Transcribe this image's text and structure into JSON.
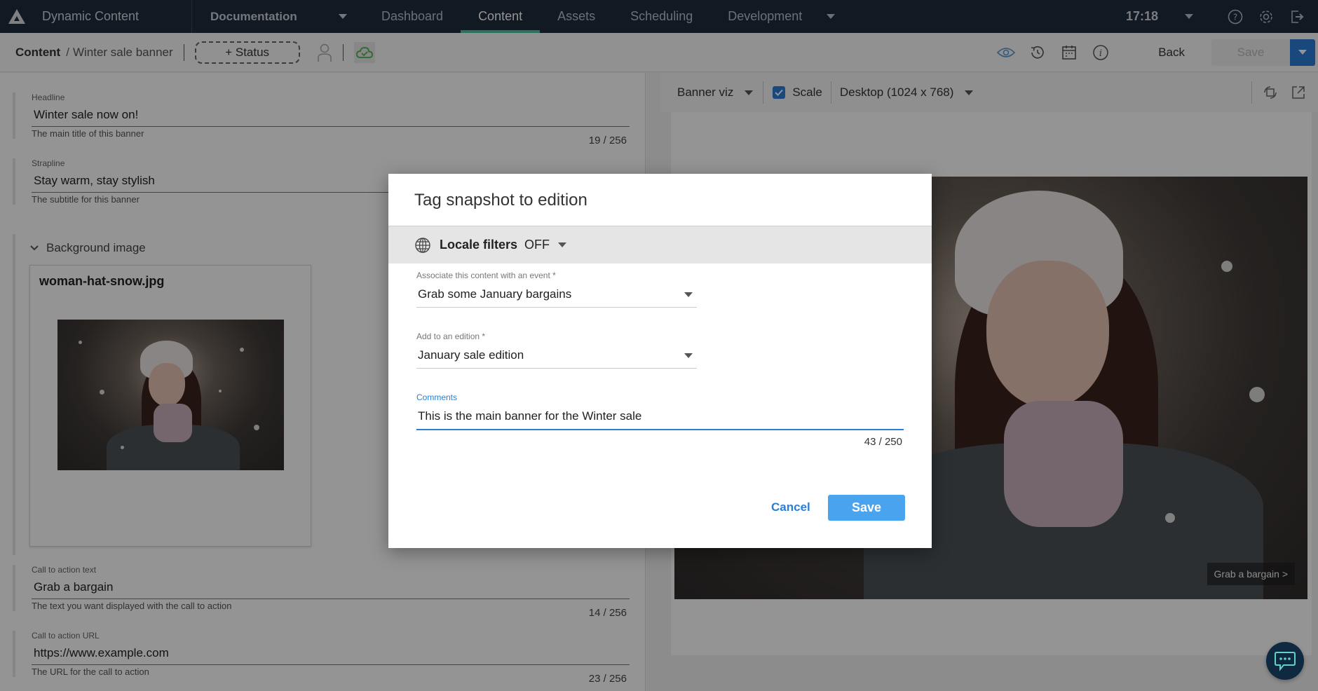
{
  "topnav": {
    "app_title": "Dynamic Content",
    "hub": "Documentation",
    "tabs": [
      {
        "label": "Dashboard",
        "active": false
      },
      {
        "label": "Content",
        "active": true
      },
      {
        "label": "Assets",
        "active": false
      },
      {
        "label": "Scheduling",
        "active": false
      },
      {
        "label": "Development",
        "active": false
      }
    ],
    "clock": "17:18",
    "icons": [
      "help-icon",
      "settings-icon",
      "logout-icon"
    ]
  },
  "toolbar": {
    "breadcrumb_root": "Content",
    "breadcrumb_sep": "/",
    "breadcrumb_current": "Winter sale banner",
    "status_label": "+ Status",
    "back_label": "Back",
    "save_label": "Save"
  },
  "form": {
    "headline": {
      "label": "Headline",
      "value": "Winter sale now on!",
      "help": "The main title of this banner",
      "count": "19 / 256"
    },
    "strapline": {
      "label": "Strapline",
      "value": "Stay warm, stay stylish",
      "help": "The subtitle for this banner"
    },
    "background": {
      "section_title": "Background image",
      "file_name": "woman-hat-snow.jpg"
    },
    "cta_text": {
      "label": "Call to action text",
      "value": "Grab a bargain",
      "help": "The text you want displayed with the call to action",
      "count": "14 / 256"
    },
    "cta_url": {
      "label": "Call to action URL",
      "value": "https://www.example.com",
      "help": "The URL for the call to action",
      "count": "23 / 256"
    }
  },
  "preview": {
    "visualization": "Banner viz",
    "scale_label": "Scale",
    "scale_checked": true,
    "device": "Desktop (1024 x 768)",
    "cta_chip": "Grab a bargain >"
  },
  "modal": {
    "title": "Tag snapshot to edition",
    "locale_label": "Locale filters",
    "locale_value": "OFF",
    "event_label": "Associate this content with an event *",
    "event_value": "Grab some January bargains",
    "edition_label": "Add to an edition *",
    "edition_value": "January sale edition",
    "comments_label": "Comments",
    "comments_value": "This is the main banner for the Winter sale",
    "comments_count": "43 / 250",
    "cancel_label": "Cancel",
    "save_label": "Save"
  },
  "colors": {
    "nav_bg": "#1e2d3d",
    "active_tab": "#4cc4a0",
    "accent": "#2b7ed6",
    "save_button": "#4aa3ef"
  }
}
